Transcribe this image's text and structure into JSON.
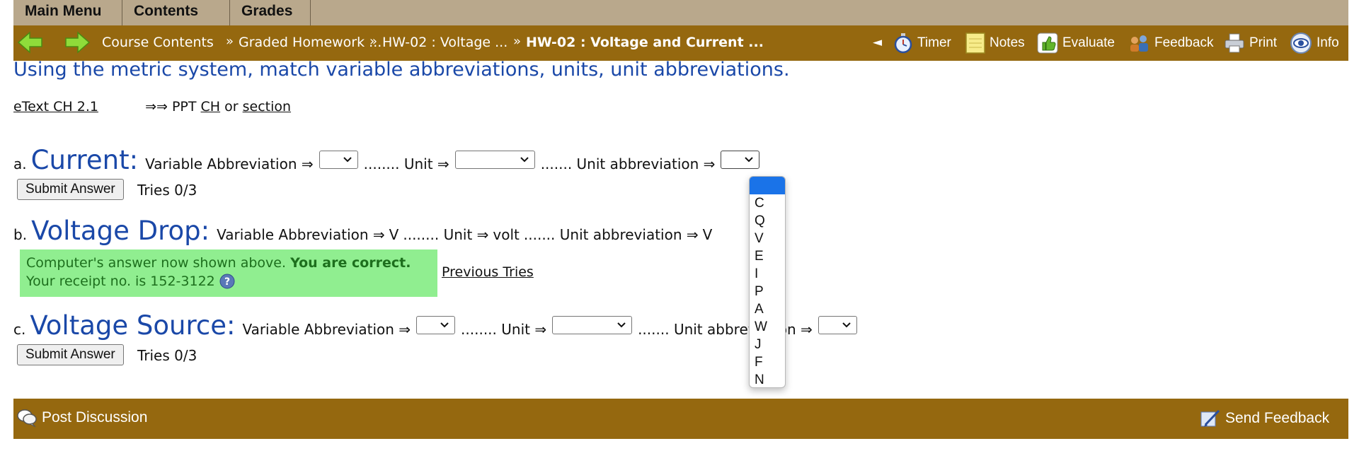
{
  "tabs": [
    "Main Menu",
    "Contents",
    "Grades"
  ],
  "nav": {
    "breadcrumbs": [
      "Course Contents",
      "Graded Homework ...",
      "HW-02 : Voltage ...",
      "HW-02 : Voltage and Current ..."
    ],
    "separator": "»",
    "collapse": "◄",
    "tools": [
      "Timer",
      "Notes",
      "Evaluate",
      "Feedback",
      "Print",
      "Info"
    ]
  },
  "instructions": "Using the metric system, match variable abbreviations, units, unit abbreviations.",
  "refs": {
    "etext": "eText CH 2.1",
    "arrows": "⇒⇒",
    "ppt": "PPT",
    "ch": "CH",
    "or": "or",
    "section": "section"
  },
  "labels": {
    "var_abbr": "Variable Abbreviation ⇒",
    "unit": "........ Unit ⇒",
    "unit_abbr": "....... Unit abbreviation ⇒",
    "submit": "Submit Answer",
    "previous_tries": "Previous Tries"
  },
  "questions": {
    "a": {
      "letter": "a.",
      "title": "Current:",
      "tries": "Tries 0/3"
    },
    "b": {
      "letter": "b.",
      "title": "Voltage Drop:",
      "var_value": "V",
      "unit_value": "volt",
      "abbr_value": "V"
    },
    "c": {
      "letter": "c.",
      "title": "Voltage Source:",
      "tries": "Tries 0/3"
    }
  },
  "correct": {
    "line1_prefix": "Computer's answer now shown above.",
    "line1_bold": "You are correct.",
    "line2": "Your receipt no. is 152-3122"
  },
  "dropdown_options": [
    "",
    "C",
    "Q",
    "V",
    "E",
    "I",
    "P",
    "A",
    "W",
    "J",
    "F",
    "N"
  ],
  "footer": {
    "post_discussion": "Post Discussion",
    "send_feedback": "Send Feedback"
  },
  "colors": {
    "navbar": "#95680f",
    "tabs": "#b9a88c",
    "title_blue": "#1a48a8",
    "correct_bg": "#90ee90"
  }
}
